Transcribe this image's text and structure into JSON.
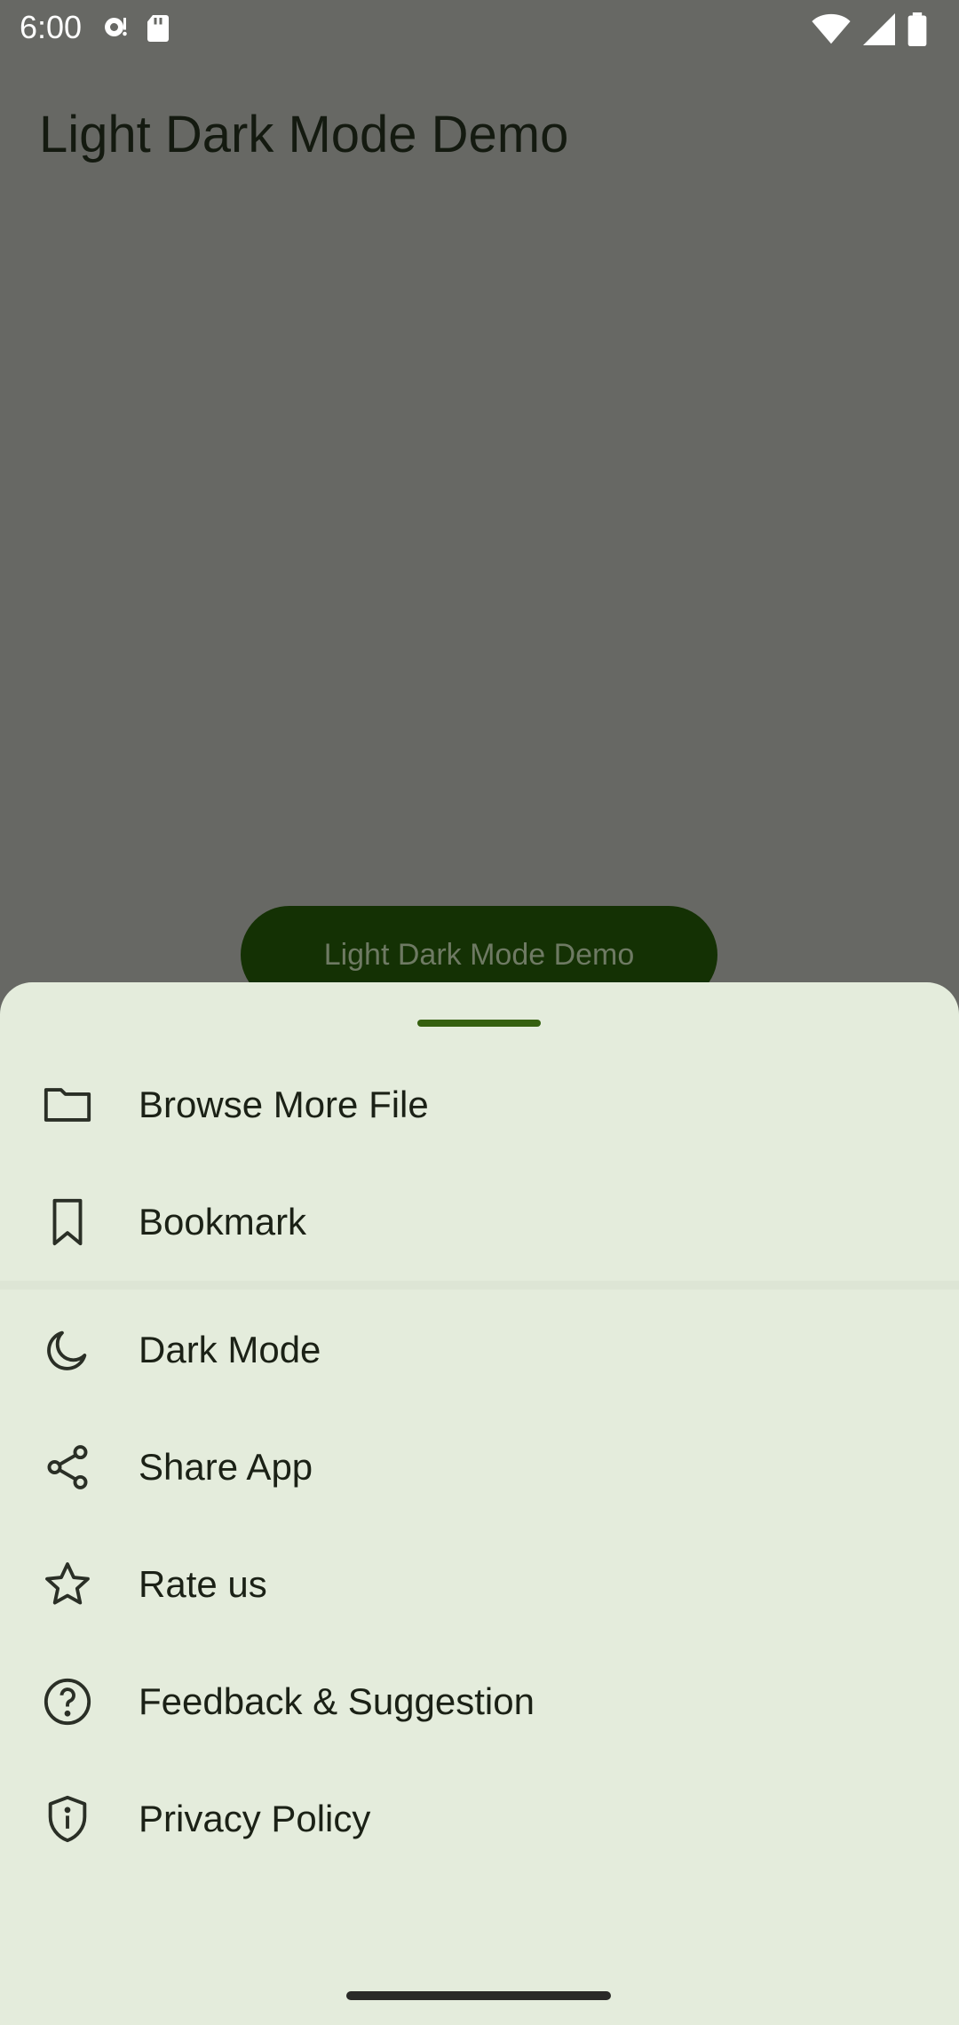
{
  "status_bar": {
    "time": "6:00",
    "icons": [
      "podcast-icon",
      "sd-card-icon",
      "wifi-icon",
      "signal-icon",
      "battery-icon"
    ]
  },
  "app": {
    "title": "Light Dark Mode Demo",
    "button_label": "Light Dark Mode Demo"
  },
  "sheet": {
    "items": [
      {
        "label": "Browse More File",
        "icon": "folder-icon"
      },
      {
        "label": "Bookmark",
        "icon": "bookmark-icon"
      },
      {
        "label": "Dark Mode",
        "icon": "moon-icon"
      },
      {
        "label": "Share App",
        "icon": "share-icon"
      },
      {
        "label": "Rate us",
        "icon": "star-icon"
      },
      {
        "label": "Feedback & Suggestion",
        "icon": "help-icon"
      },
      {
        "label": "Privacy Policy",
        "icon": "shield-icon"
      }
    ]
  },
  "colors": {
    "scrim": "#676864",
    "sheet_bg": "#e4ecdc",
    "accent": "#35600f",
    "button_bg": "#143104"
  }
}
